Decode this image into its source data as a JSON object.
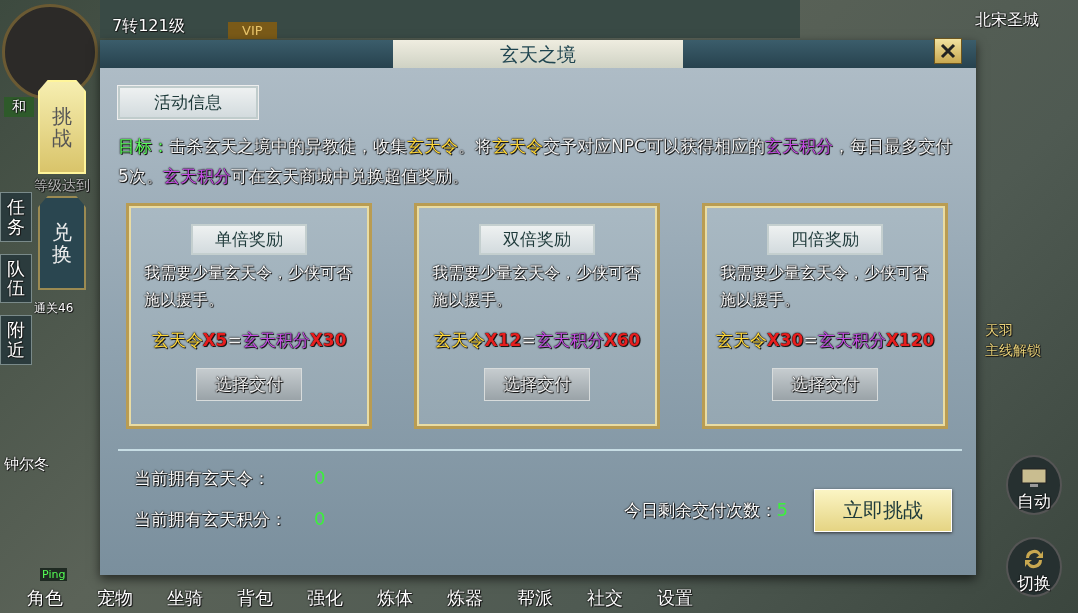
{
  "hud": {
    "level": "7转121级",
    "vip": "VIP",
    "map_name": "北宋圣城",
    "mode": "和",
    "quest_hint": "等级达到",
    "quest_progress": "通关46",
    "npc_name": "钟尔冬",
    "ping": "Ping",
    "right_quest": [
      "天羽",
      "主线解锁"
    ]
  },
  "left_tabs": [
    {
      "label": "任务"
    },
    {
      "label": "队伍"
    },
    {
      "label": "附近"
    }
  ],
  "side_tabs": [
    {
      "label": "挑战",
      "selected": true
    },
    {
      "label": "兑换",
      "selected": false
    }
  ],
  "bottom_menu": [
    "角色",
    "宠物",
    "坐骑",
    "背包",
    "强化",
    "炼体",
    "炼器",
    "帮派",
    "社交",
    "设置"
  ],
  "right_buttons": [
    {
      "label": "自动",
      "kind": "auto"
    },
    {
      "label": "切换",
      "kind": "switch"
    }
  ],
  "dialog": {
    "title": "玄天之境",
    "section_title": "活动信息",
    "description": [
      {
        "kind": "label",
        "text": "目标："
      },
      {
        "kind": "plain",
        "text": "击杀玄天之境中的异教徒，收集"
      },
      {
        "kind": "token",
        "text": "玄天令"
      },
      {
        "kind": "plain",
        "text": "。将"
      },
      {
        "kind": "token",
        "text": "玄天令"
      },
      {
        "kind": "plain",
        "text": "交予对应NPC可以获得相应的"
      },
      {
        "kind": "points",
        "text": "玄天积分"
      },
      {
        "kind": "plain",
        "text": "，每日最多交付5次。"
      },
      {
        "kind": "points",
        "text": "玄天积分"
      },
      {
        "kind": "plain",
        "text": "可在玄天商城中兑换超值奖励。"
      }
    ],
    "reward_cards": [
      {
        "title": "单倍奖励",
        "text": "我需要少量玄天令，少侠可否施以援手。",
        "formula": [
          {
            "kind": "token",
            "text": "玄天令"
          },
          {
            "kind": "count",
            "text": "X5"
          },
          {
            "kind": "eq",
            "text": "="
          },
          {
            "kind": "points",
            "text": "玄天积分"
          },
          {
            "kind": "count",
            "text": "X30"
          }
        ],
        "button": "选择交付"
      },
      {
        "title": "双倍奖励",
        "text": "我需要少量玄天令，少侠可否施以援手。",
        "formula": [
          {
            "kind": "token",
            "text": "玄天令"
          },
          {
            "kind": "count",
            "text": "X12"
          },
          {
            "kind": "eq",
            "text": "="
          },
          {
            "kind": "points",
            "text": "玄天积分"
          },
          {
            "kind": "count",
            "text": "X60"
          }
        ],
        "button": "选择交付"
      },
      {
        "title": "四倍奖励",
        "text": "我需要少量玄天令，少侠可否施以援手。",
        "formula": [
          {
            "kind": "token",
            "text": "玄天令"
          },
          {
            "kind": "count",
            "text": "X30"
          },
          {
            "kind": "eq",
            "text": "="
          },
          {
            "kind": "points",
            "text": "玄天积分"
          },
          {
            "kind": "count",
            "text": "X120"
          }
        ],
        "button": "选择交付"
      }
    ],
    "footer": {
      "owned_tokens_label": "当前拥有玄天令：",
      "owned_tokens": "0",
      "owned_points_label": "当前拥有玄天积分：",
      "owned_points": "0",
      "remaining_label": "今日剩余交付次数：",
      "remaining": "5",
      "challenge_button": "立即挑战"
    }
  }
}
